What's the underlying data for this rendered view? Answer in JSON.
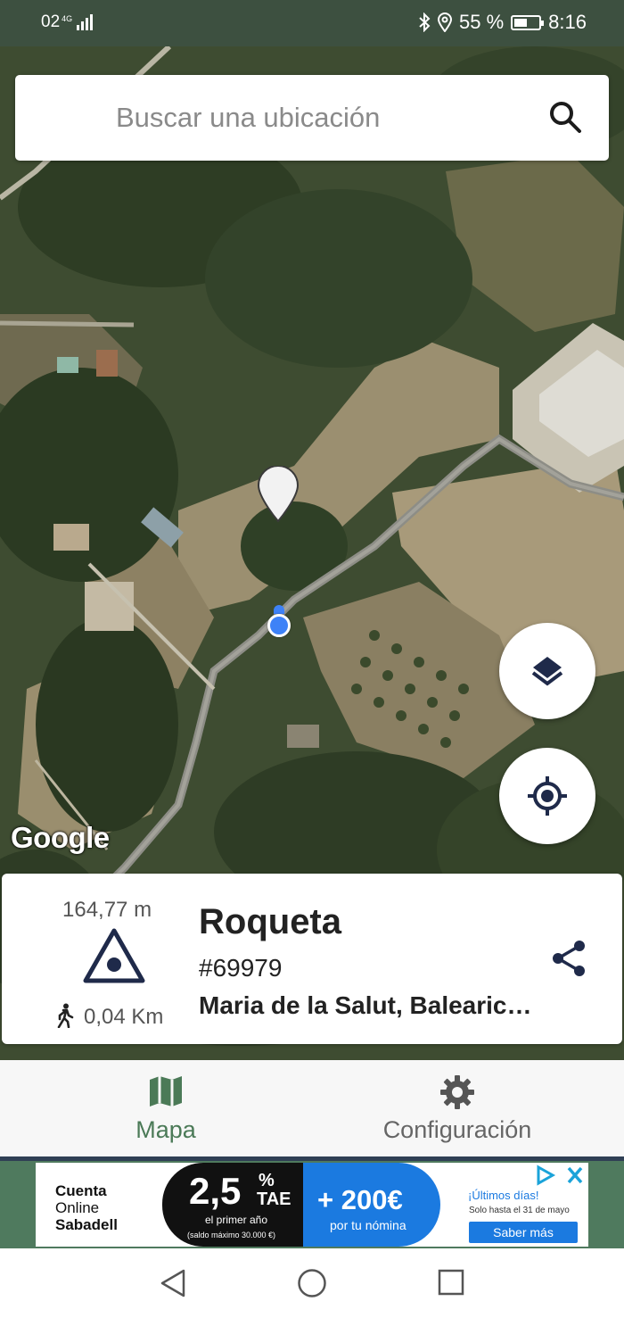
{
  "status_bar": {
    "left_text": "02",
    "network": "4G",
    "battery_percent_text": "55 %",
    "battery_level": 0.55,
    "time": "8:16"
  },
  "search": {
    "placeholder": "Buscar una ubicación",
    "icon": "search-icon"
  },
  "map": {
    "attribution": "Google",
    "layers_button_icon": "layers-icon",
    "locate_button_icon": "my-location-icon"
  },
  "place": {
    "elevation": "164,77 m",
    "name": "Roqueta",
    "id": "#69979",
    "region": "Maria de la Salut, Balearic…",
    "distance": "0,04 Km",
    "share_icon": "share-icon"
  },
  "nav": {
    "items": [
      {
        "label": "Mapa",
        "icon": "map-icon",
        "active": true
      },
      {
        "label": "Configuración",
        "icon": "gear-icon",
        "active": false
      }
    ],
    "active_color": "#4b7a57"
  },
  "ad": {
    "brand_line1": "Cuenta",
    "brand_line2": "Online",
    "brand_line3": "Sabadell",
    "rate": "2,5",
    "rate_pct": "%",
    "rate_tae": "TAE",
    "rate_sub": "el primer año",
    "rate_max": "(saldo máximo 30.000 €)",
    "bonus": "+ 200€",
    "bonus_sub": "por tu nómina",
    "last_days": "¡Últimos días!",
    "until": "Solo hasta el 31 de mayo",
    "cta": "Saber más"
  },
  "system_nav": {
    "back_icon": "back-triangle-icon",
    "home_icon": "home-circle-icon",
    "recents_icon": "recents-square-icon"
  }
}
